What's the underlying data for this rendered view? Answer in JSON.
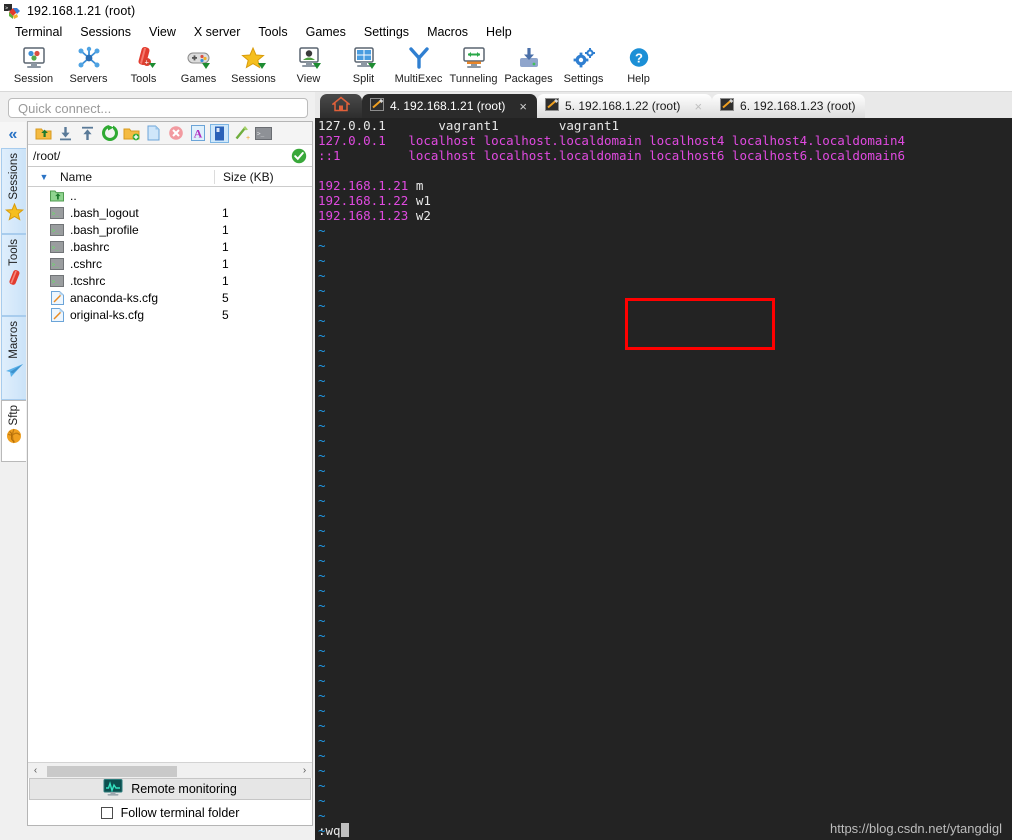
{
  "window": {
    "title": "192.168.1.21 (root)",
    "app_icon": "mobaxterm-icon"
  },
  "menubar": {
    "items": [
      {
        "label": "Terminal"
      },
      {
        "label": "Sessions"
      },
      {
        "label": "View"
      },
      {
        "label": "X server"
      },
      {
        "label": "Tools"
      },
      {
        "label": "Games"
      },
      {
        "label": "Settings"
      },
      {
        "label": "Macros"
      },
      {
        "label": "Help"
      }
    ]
  },
  "toolbar": {
    "buttons": [
      {
        "label": "Session",
        "icon": "session-icon"
      },
      {
        "label": "Servers",
        "icon": "servers-icon"
      },
      {
        "label": "Tools",
        "icon": "tools-icon"
      },
      {
        "label": "Games",
        "icon": "games-icon"
      },
      {
        "label": "Sessions",
        "icon": "sessions-star-icon"
      },
      {
        "label": "View",
        "icon": "view-icon"
      },
      {
        "label": "Split",
        "icon": "split-icon"
      },
      {
        "label": "MultiExec",
        "icon": "multiexec-icon"
      },
      {
        "label": "Tunneling",
        "icon": "tunneling-icon"
      },
      {
        "label": "Packages",
        "icon": "packages-icon"
      },
      {
        "label": "Settings",
        "icon": "settings-gear-icon"
      },
      {
        "label": "Help",
        "icon": "help-icon"
      }
    ]
  },
  "sidebar": {
    "quick_connect_placeholder": "Quick connect...",
    "collapse_glyph": "«",
    "tabs": [
      {
        "label": "Sessions",
        "icon": "star-icon",
        "active": false
      },
      {
        "label": "Tools",
        "icon": "swiss-knife-icon",
        "active": false
      },
      {
        "label": "Macros",
        "icon": "paper-plane-icon",
        "active": false
      },
      {
        "label": "Sftp",
        "icon": "globe-icon",
        "active": true
      }
    ]
  },
  "sftp": {
    "toolbar_icons": [
      {
        "name": "parent-folder-icon",
        "selected": false
      },
      {
        "name": "download-icon",
        "selected": false
      },
      {
        "name": "upload-icon",
        "selected": false
      },
      {
        "name": "refresh-icon",
        "selected": false
      },
      {
        "name": "new-folder-icon",
        "selected": false
      },
      {
        "name": "new-file-icon",
        "selected": false
      },
      {
        "name": "delete-icon",
        "selected": false
      },
      {
        "name": "text-mode-icon",
        "selected": false
      },
      {
        "name": "binary-mode-icon",
        "selected": true
      },
      {
        "name": "permissions-icon",
        "selected": false
      },
      {
        "name": "terminal-icon",
        "selected": false
      }
    ],
    "path": "/root/",
    "path_ok_icon": "check-circle-icon",
    "columns": [
      "Name",
      "Size (KB)"
    ],
    "sort_glyph": "▼",
    "files": [
      {
        "name": "..",
        "size": "",
        "icon": "parent-dir-icon"
      },
      {
        "name": ".bash_logout",
        "size": "1",
        "icon": "script-file-icon"
      },
      {
        "name": ".bash_profile",
        "size": "1",
        "icon": "script-file-icon"
      },
      {
        "name": ".bashrc",
        "size": "1",
        "icon": "script-file-icon"
      },
      {
        "name": ".cshrc",
        "size": "1",
        "icon": "script-file-icon"
      },
      {
        "name": ".tcshrc",
        "size": "1",
        "icon": "script-file-icon"
      },
      {
        "name": "anaconda-ks.cfg",
        "size": "5",
        "icon": "text-file-icon"
      },
      {
        "name": "original-ks.cfg",
        "size": "5",
        "icon": "text-file-icon"
      }
    ],
    "scroll_left_glyph": "‹",
    "scroll_right_glyph": "›",
    "remote_monitoring_label": "Remote monitoring",
    "remote_monitoring_icon": "monitor-graph-icon",
    "follow_terminal_label": "Follow terminal folder",
    "follow_terminal_checked": false
  },
  "tabs": {
    "home_icon": "home-icon",
    "items": [
      {
        "label": "4. 192.168.1.21 (root)",
        "icon": "terminal-plug-icon",
        "active": true,
        "close_glyph": "×"
      },
      {
        "label": "5. 192.168.1.22 (root)",
        "icon": "terminal-plug-icon",
        "active": false,
        "close_glyph": "×"
      },
      {
        "label": "6. 192.168.1.23 (root)",
        "icon": "terminal-plug-icon",
        "active": false,
        "close_glyph": ""
      }
    ]
  },
  "terminal": {
    "lines": [
      {
        "segments": [
          {
            "text": "127.0.0.1       vagrant1        vagrant1",
            "color": "white"
          }
        ]
      },
      {
        "segments": [
          {
            "text": "127.0.0.1",
            "color": "magenta"
          },
          {
            "text": "   ",
            "color": "white"
          },
          {
            "text": "localhost localhost.localdomain localhost4 localhost4.localdomain4",
            "color": "magenta"
          }
        ]
      },
      {
        "segments": [
          {
            "text": "::1",
            "color": "magenta"
          },
          {
            "text": "         ",
            "color": "white"
          },
          {
            "text": "localhost localhost.localdomain localhost6 localhost6.localdomain6",
            "color": "magenta"
          }
        ]
      },
      {
        "segments": [
          {
            "text": "",
            "color": "white"
          }
        ]
      },
      {
        "segments": [
          {
            "text": "192.168.1.21 ",
            "color": "magenta"
          },
          {
            "text": "m",
            "color": "white"
          }
        ]
      },
      {
        "segments": [
          {
            "text": "192.168.1.22 ",
            "color": "magenta"
          },
          {
            "text": "w1",
            "color": "white"
          }
        ]
      },
      {
        "segments": [
          {
            "text": "192.168.1.23 ",
            "color": "magenta"
          },
          {
            "text": "w2",
            "color": "white"
          }
        ]
      }
    ],
    "empty_marker": "~",
    "empty_marker_count": 41,
    "command_line": ":wq",
    "cursor": "block",
    "colors": {
      "background": "#232323",
      "white": "#e8e8e8",
      "magenta": "#e04ae0",
      "blue": "#1f9ae8"
    }
  },
  "annotation": {
    "highlight_box_color": "#ff0000"
  },
  "watermark": {
    "text": "https://blog.csdn.net/ytangdigl"
  }
}
